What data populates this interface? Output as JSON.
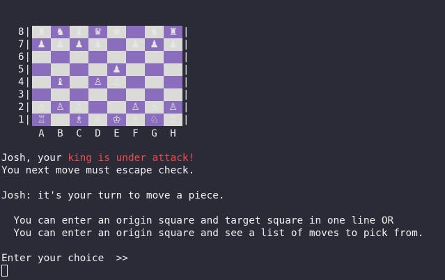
{
  "board": {
    "ranks": [
      "8",
      "7",
      "6",
      "5",
      "4",
      "3",
      "2",
      "1"
    ],
    "files": [
      "A",
      "B",
      "C",
      "D",
      "E",
      "F",
      "G",
      "H"
    ],
    "rank_separator": "|",
    "pieces": [
      [
        "♜",
        "♞",
        "♝",
        "♛",
        "♚",
        "",
        "♞",
        "♜"
      ],
      [
        "♟",
        "♟",
        "♟",
        "♟",
        "",
        "♟",
        "♟",
        "♟"
      ],
      [
        "",
        "",
        "",
        "",
        "",
        "",
        "",
        ""
      ],
      [
        "",
        "",
        "",
        "",
        "♟",
        "",
        "",
        ""
      ],
      [
        "",
        "♝",
        "",
        "♙",
        "♙",
        "",
        "",
        ""
      ],
      [
        "",
        "",
        "",
        "",
        "",
        "",
        "",
        ""
      ],
      [
        "♙",
        "♙",
        "♙",
        "",
        "",
        "♙",
        "♙",
        "♙"
      ],
      [
        "♖",
        "♘",
        "♗",
        "♕",
        "♔",
        "♗",
        "♘",
        "♖"
      ]
    ],
    "colors": {
      "light_square": "#dadbd6",
      "dark_square": "#8a6dbd"
    }
  },
  "messages": {
    "check_prefix": "Josh, your ",
    "check_alert": "king is under attack!",
    "escape_check": "You next move must escape check.",
    "turn": "Josh: it's your turn to move a piece.",
    "option_one": "  You can enter an origin square and target square in one line OR",
    "option_two": "  You can enter an origin square and see a list of moves to pick from.",
    "prompt": "Enter your choice  >>"
  },
  "colors": {
    "background": "#2a2b36",
    "text": "#f0f0f0",
    "alert": "#f04848"
  }
}
